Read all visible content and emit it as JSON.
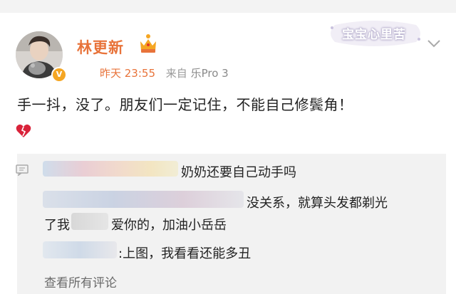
{
  "post": {
    "username": "林更新",
    "time": "昨天 23:55",
    "source_label": "来自",
    "device": "乐Pro 3",
    "verified_mark": "V",
    "text": "手一抖，没了。朋友们一定记住，不能自己修鬓角！",
    "emoji_name": "broken-heart-icon"
  },
  "watermark": {
    "text": "宝宝心里苦"
  },
  "comments": {
    "c1": {
      "text": "奶奶还要自己动手吗"
    },
    "c2": {
      "line1": "没关系，就算头发都剃光",
      "line2_a": "了我",
      "line2_b": "爱你的，加油小岳岳"
    },
    "c3": {
      "text": ":上图，我看看还能多丑"
    },
    "see_all": "查看所有评论"
  },
  "colors": {
    "accent": "#e8733a",
    "verified": "#f5a623",
    "comment_bg": "#f2f2f2"
  }
}
